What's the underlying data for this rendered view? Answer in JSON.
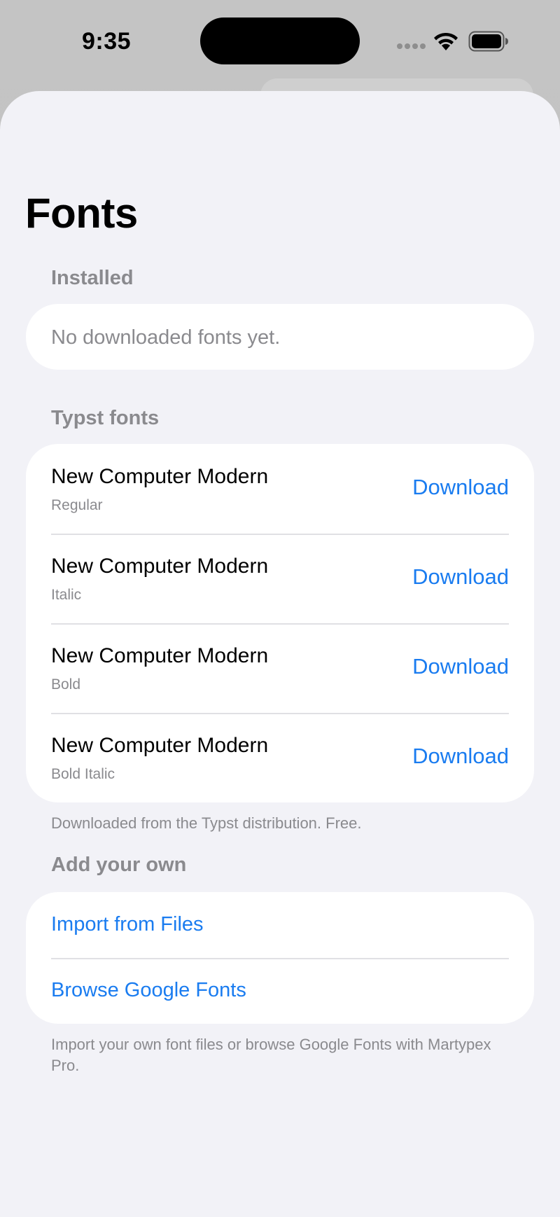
{
  "status_bar": {
    "time": "9:35"
  },
  "page": {
    "title": "Fonts"
  },
  "installed": {
    "header": "Installed",
    "empty_text": "No downloaded fonts yet."
  },
  "typst_fonts": {
    "header": "Typst fonts",
    "items": [
      {
        "name": "New Computer Modern",
        "style": "Regular",
        "action": "Download"
      },
      {
        "name": "New Computer Modern",
        "style": "Italic",
        "action": "Download"
      },
      {
        "name": "New Computer Modern",
        "style": "Bold",
        "action": "Download"
      },
      {
        "name": "New Computer Modern",
        "style": "Bold Italic",
        "action": "Download"
      }
    ],
    "footer": "Downloaded from the Typst distribution. Free."
  },
  "add_your_own": {
    "header": "Add your own",
    "import_label": "Import from Files",
    "browse_label": "Browse Google Fonts",
    "footer": "Import your own font files or browse Google Fonts with Martypex Pro."
  },
  "colors": {
    "accent": "#1a7cf0",
    "background": "#f2f2f7",
    "secondary_text": "#8a8a8e"
  }
}
